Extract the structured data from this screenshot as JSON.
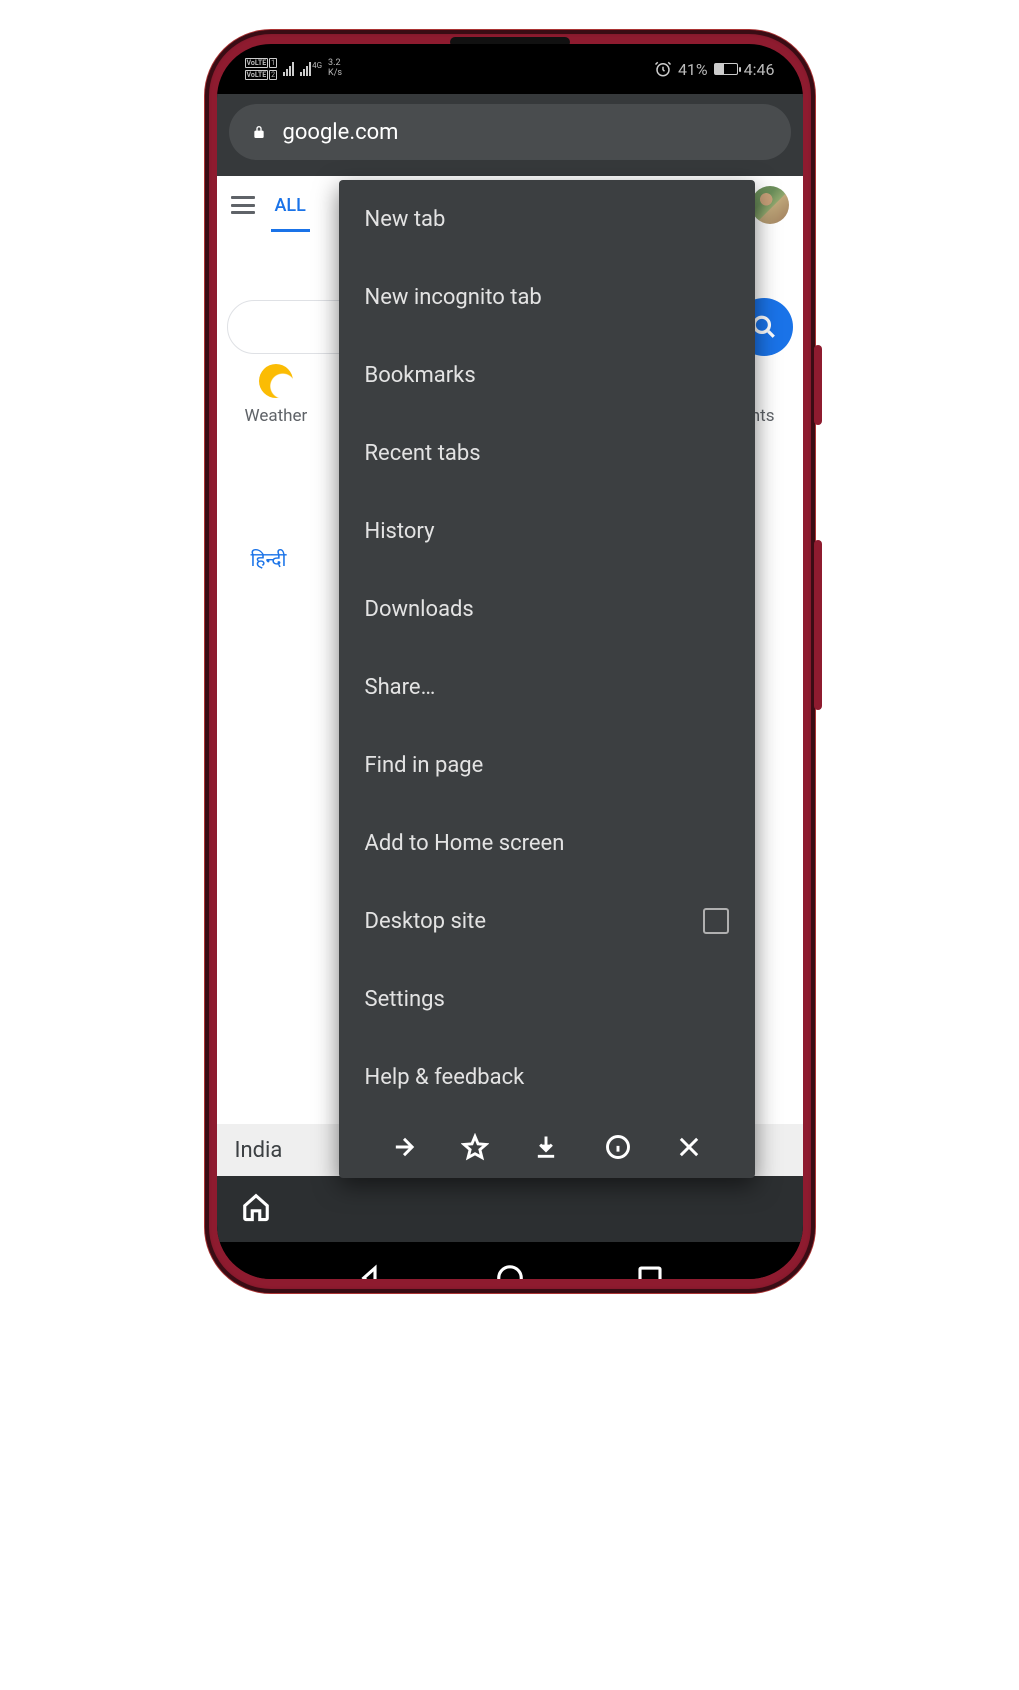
{
  "status": {
    "volte1": "VoLTE",
    "volte2": "VoLTE",
    "net_label": "4G",
    "speed_top": "3.2",
    "speed_bot": "K/s",
    "battery_pct": "41%",
    "time": "4:46"
  },
  "urlbar": {
    "url": "google.com"
  },
  "page": {
    "tab_all": "ALL",
    "search_hint": "",
    "weather_label": "Weather",
    "right_label": "nts",
    "lang_hindi": "हिन्दी",
    "footer": "India"
  },
  "menu": {
    "items": [
      "New tab",
      "New incognito tab",
      "Bookmarks",
      "Recent tabs",
      "History",
      "Downloads",
      "Share…",
      "Find in page",
      "Add to Home screen",
      "Desktop site",
      "Settings",
      "Help & feedback"
    ]
  }
}
